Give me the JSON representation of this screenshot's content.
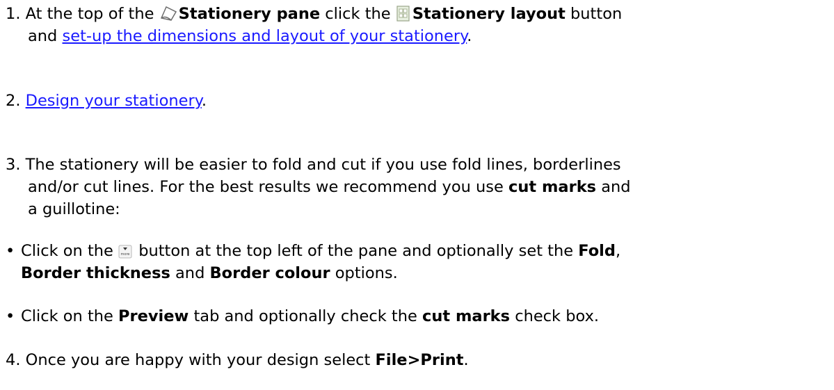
{
  "steps": [
    {
      "number": "1.",
      "text_1": "At the top of the",
      "pane_icon": "stationery-pane-icon",
      "pane_label": "Stationery pane",
      "text_2": "click the",
      "layout_icon": "stationery-layout-icon",
      "layout_label": "Stationery layout",
      "text_3": "button",
      "text_4": "and",
      "link": "set-up the dimensions and layout of your stationery",
      "text_5": "."
    },
    {
      "number": "2.",
      "link": "Design your stationery",
      "text_1": "."
    },
    {
      "number": "3.",
      "line_1": "The stationery will be easier to fold and cut if you use fold lines, borderlines",
      "line_2a": "and/or cut lines. For the best results we recommend you use",
      "line_2b": "cut marks",
      "line_2c": "and",
      "line_3": "a guillotine:"
    }
  ],
  "bullets": [
    {
      "symbol": "•",
      "text_1": "Click on the",
      "icon": "more-button-icon",
      "icon_label": "more",
      "text_2": "button at the top left of the pane and optionally set the",
      "bold_1": "Fold",
      "text_3": ",",
      "bold_2": "Border thickness",
      "text_4": "and",
      "bold_3": "Border colour",
      "text_5": "options."
    },
    {
      "symbol": "•",
      "text_1": "Click on the",
      "bold_1": "Preview",
      "text_2": "tab and optionally check the",
      "bold_2": "cut marks",
      "text_3": "check box."
    }
  ],
  "final_step": {
    "number": "4.",
    "text_1": "Once you are happy with your design select",
    "bold_1": "File>Print",
    "text_2": "."
  },
  "colors": {
    "link": "#1a1aff",
    "text": "#000000",
    "background": "#ffffff"
  }
}
